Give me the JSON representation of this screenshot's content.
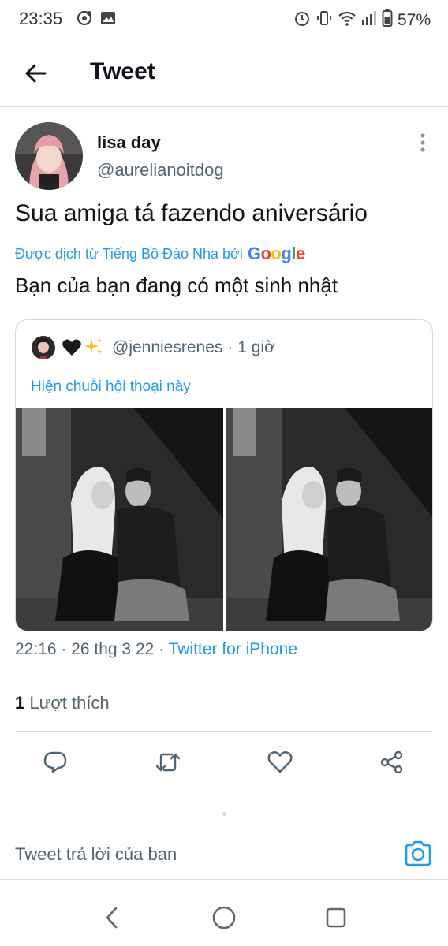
{
  "status_bar": {
    "time": "23:35",
    "battery": "57%",
    "icons": [
      "notification-icon",
      "image-icon",
      "alarm-icon",
      "vibrate-icon",
      "wifi-icon",
      "signal-icon",
      "battery-icon"
    ]
  },
  "header": {
    "title": "Tweet"
  },
  "tweet": {
    "author_name": "lisa day",
    "author_handle": "@aurelianoitdog",
    "text": "Sua amiga tá fazendo aniversário",
    "translated_by": "Được dịch từ Tiếng Bồ Đào Nha bởi",
    "translator": "Google",
    "translation": "Bạn của bạn đang có một sinh nhật",
    "timestamp": "22:16 · 26 thg 3 22 · ",
    "source": "Twitter for iPhone",
    "like_count": "1",
    "like_label": " Lượt thích"
  },
  "quoted": {
    "handle": "@jenniesrenes",
    "time": "· 1 giờ",
    "emojis": "🖤✨",
    "show_thread": "Hiện chuỗi hội thoại này"
  },
  "reply": {
    "placeholder": "Tweet trả lời của bạn"
  },
  "colors": {
    "accent": "#1d9bf0",
    "text": "#0f1419",
    "secondary": "#536471",
    "divider": "#dcdcdc",
    "google_blue": "#4285F4",
    "google_red": "#EA4335",
    "google_yellow": "#FBBC05",
    "google_green": "#34A853"
  }
}
